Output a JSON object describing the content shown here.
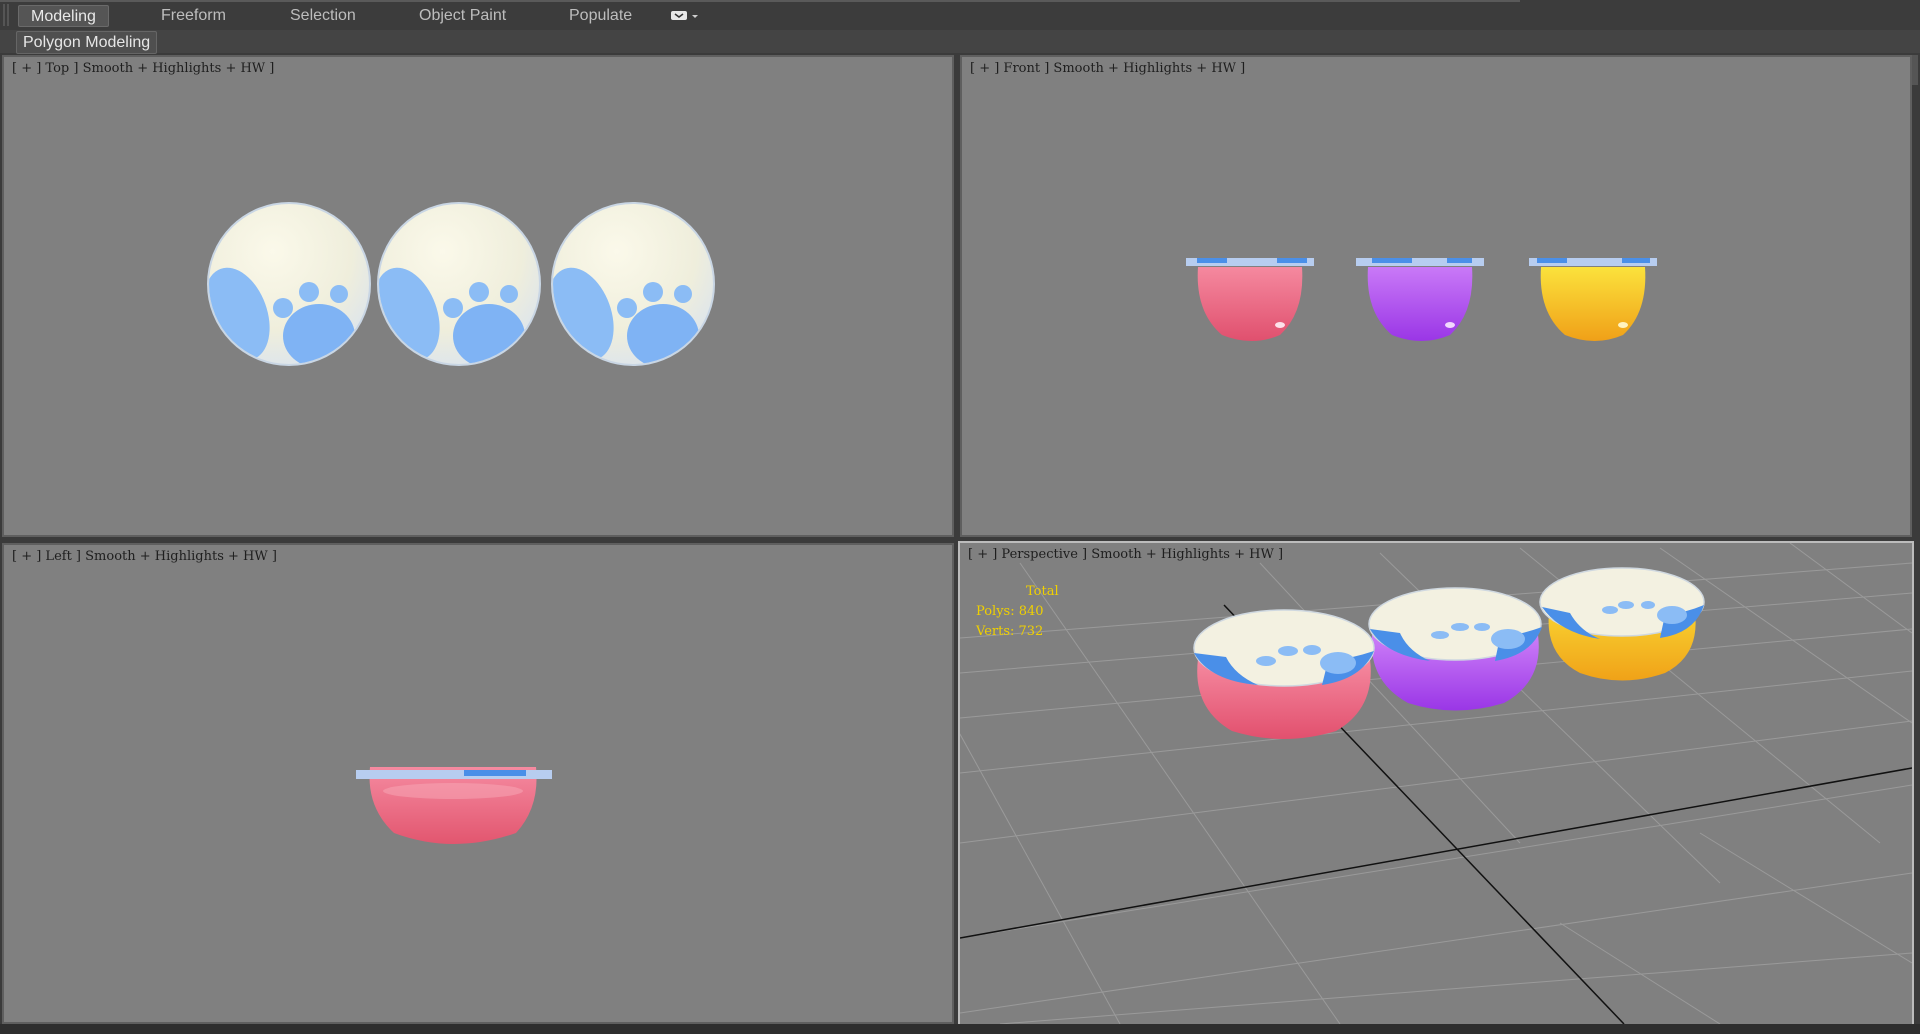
{
  "ribbon": {
    "tabs": [
      {
        "label": "Modeling",
        "active": true
      },
      {
        "label": "Freeform",
        "active": false
      },
      {
        "label": "Selection",
        "active": false
      },
      {
        "label": "Object Paint",
        "active": false
      },
      {
        "label": "Populate",
        "active": false
      }
    ],
    "dropdown_icon": "ribbon-toggle-icon",
    "subtab": "Polygon Modeling"
  },
  "viewports": {
    "top": {
      "label": "[ + ] Top ] Smooth + Highlights + HW ]",
      "active": false
    },
    "front": {
      "label": "[ + ] Front ] Smooth + Highlights + HW ]",
      "active": false
    },
    "left": {
      "label": "[ + ] Left ] Smooth + Highlights + HW ]",
      "active": false
    },
    "perspective": {
      "label": "[ + ] Perspective ] Smooth + Highlights + HW ]",
      "active": true
    }
  },
  "stats": {
    "header": "Total",
    "polys": "Polys: 840",
    "verts": "Verts: 732"
  },
  "colors": {
    "viewport_bg": "#808080",
    "lid": "#f4f2e2",
    "paw": "#8bbcf5",
    "paw_dark": "#4a8fe8",
    "cup_pink": "#f06a86",
    "cup_purple": "#b04cf0",
    "cup_yellow": "#f4b418",
    "stats_text": "#f0d000"
  },
  "scene": {
    "objects": [
      "pink cup",
      "purple cup",
      "yellow cup"
    ]
  }
}
